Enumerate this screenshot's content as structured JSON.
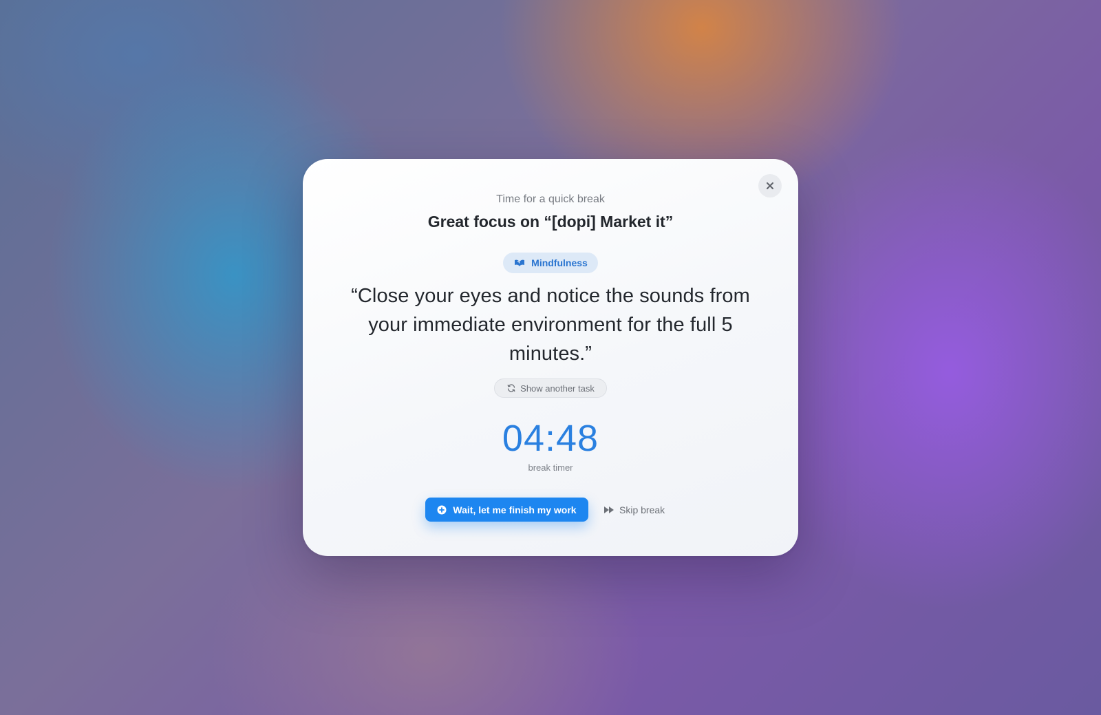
{
  "dialog": {
    "subtitle": "Time for a quick break",
    "title": "Great focus on “[dopi] Market it”",
    "category_tag": {
      "label": "Mindfulness",
      "icon": "mindfulness-icon"
    },
    "task_quote": "“Close your eyes and notice the sounds from your immediate environment for the full 5 minutes.”",
    "show_another": {
      "label": "Show another task",
      "icon": "refresh-icon"
    },
    "timer": {
      "value": "04:48",
      "label": "break timer"
    },
    "actions": {
      "wait_label": "Wait, let me finish my work",
      "wait_icon": "plus-circle-icon",
      "skip_label": "Skip break",
      "skip_icon": "fast-forward-icon"
    },
    "close_icon": "close-icon"
  },
  "colors": {
    "accent": "#1d86f0",
    "timer": "#2a80e0",
    "tag_bg": "#dde9f7",
    "tag_text": "#2a75d0"
  }
}
